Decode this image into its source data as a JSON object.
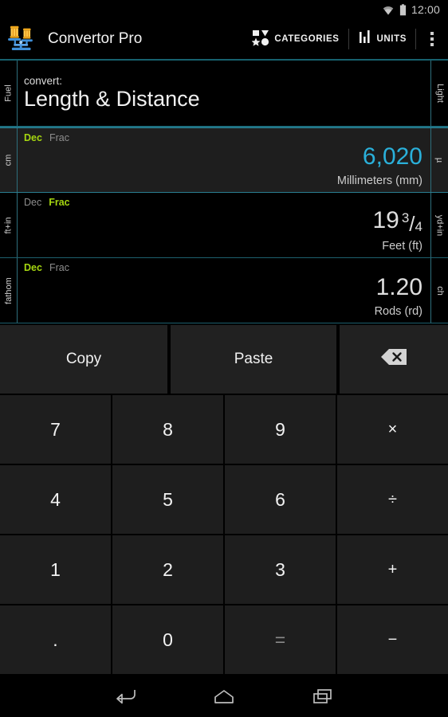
{
  "status_bar": {
    "clock": "12:00",
    "wifi_icon": "wifi-icon",
    "battery_icon": "battery-full-icon"
  },
  "action_bar": {
    "app_icon": "balance-scale-icon",
    "title": "Convertor Pro",
    "categories_label": "CATEGORIES",
    "categories_icon": "shapes-icon",
    "units_label": "UNITS",
    "units_icon": "bars-icon",
    "overflow_icon": "overflow-menu-icon"
  },
  "convert_header": {
    "kicker": "convert:",
    "title": "Length & Distance",
    "left_label": "Fuel",
    "right_label": "Light"
  },
  "rows": [
    {
      "active": true,
      "left_label": "cm",
      "right_label": "µ",
      "mode_dec": "Dec",
      "mode_frac": "Frac",
      "mode_selected": "Dec",
      "value": "6,020",
      "unit": "Millimeters (mm)"
    },
    {
      "active": false,
      "left_label": "ft+in",
      "right_label": "yd+in",
      "mode_dec": "Dec",
      "mode_frac": "Frac",
      "mode_selected": "Frac",
      "value": "19",
      "frac_numerator": "3",
      "frac_slash": "/",
      "frac_denominator": "4",
      "unit": "Feet (ft)"
    },
    {
      "active": false,
      "left_label": "fathom",
      "right_label": "ch",
      "mode_dec": "Dec",
      "mode_frac": "Frac",
      "mode_selected": "Dec",
      "value": "1.20",
      "unit": "Rods (rd)"
    }
  ],
  "edit_row": {
    "copy_label": "Copy",
    "paste_label": "Paste",
    "backspace_icon": "backspace-icon"
  },
  "keypad": {
    "keys": [
      {
        "label": "7",
        "kind": "digit"
      },
      {
        "label": "8",
        "kind": "digit"
      },
      {
        "label": "9",
        "kind": "digit"
      },
      {
        "label": "×",
        "kind": "op"
      },
      {
        "label": "4",
        "kind": "digit"
      },
      {
        "label": "5",
        "kind": "digit"
      },
      {
        "label": "6",
        "kind": "digit"
      },
      {
        "label": "÷",
        "kind": "op"
      },
      {
        "label": "1",
        "kind": "digit"
      },
      {
        "label": "2",
        "kind": "digit"
      },
      {
        "label": "3",
        "kind": "digit"
      },
      {
        "label": "+",
        "kind": "op"
      },
      {
        "label": ".",
        "kind": "dot"
      },
      {
        "label": "0",
        "kind": "digit"
      },
      {
        "label": "=",
        "kind": "dim"
      },
      {
        "label": "−",
        "kind": "op"
      }
    ]
  },
  "nav_bar": {
    "back_icon": "back-icon",
    "home_icon": "home-icon",
    "recents_icon": "recents-icon"
  },
  "colors": {
    "accent_cyan": "#2ab0da",
    "mode_active_green": "#a5d610",
    "divider_teal": "#2a7f92",
    "key_bg": "#1e1e1e",
    "background": "#000000"
  }
}
